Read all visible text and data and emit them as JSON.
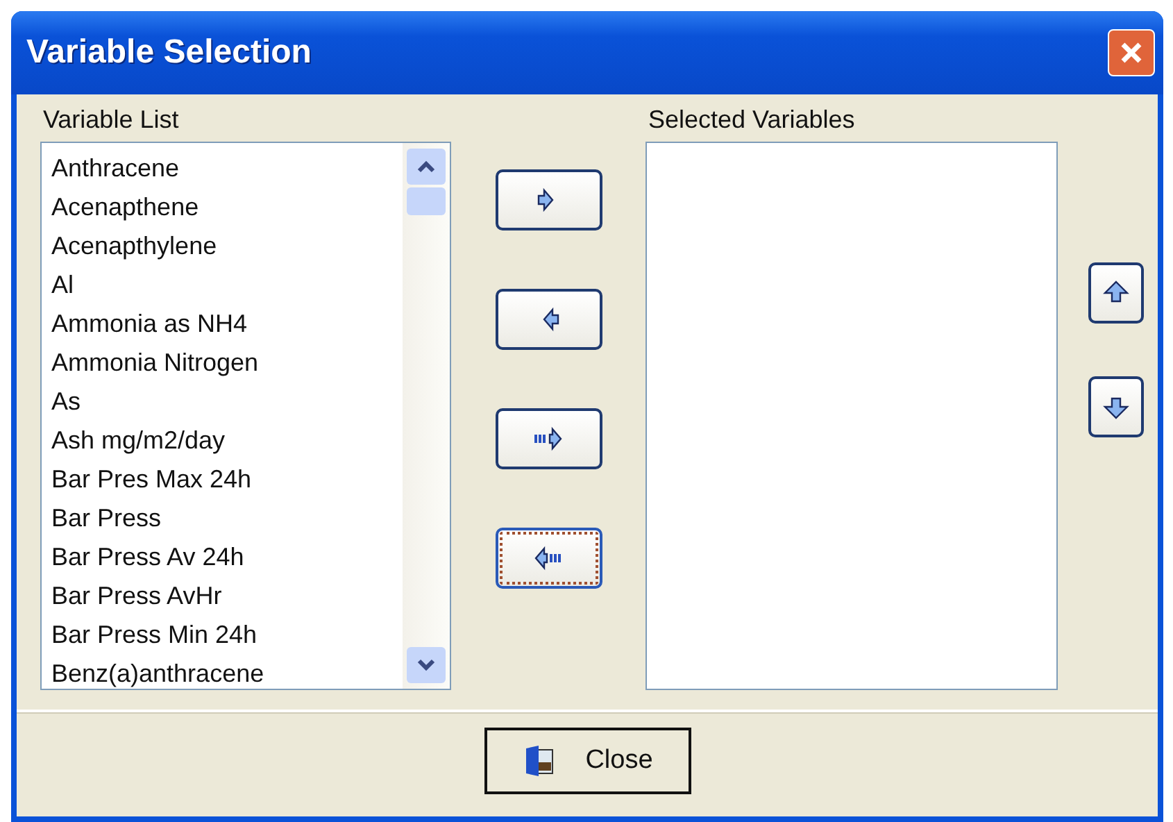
{
  "window": {
    "title": "Variable Selection"
  },
  "variable_list": {
    "label": "Variable List",
    "items": [
      "Anthracene",
      "Acenapthene",
      "Acenapthylene",
      "Al",
      "Ammonia as NH4",
      "Ammonia Nitrogen",
      "As",
      "Ash mg/m2/day",
      "Bar Pres Max 24h",
      "Bar Press",
      "Bar Press Av 24h",
      "Bar Press AvHr",
      "Bar Press Min 24h",
      "Benz(a)anthracene"
    ]
  },
  "transfer_buttons": [
    {
      "kind": "add",
      "focused": false
    },
    {
      "kind": "remove",
      "focused": false
    },
    {
      "kind": "add-all",
      "focused": false
    },
    {
      "kind": "remove-all",
      "focused": true
    }
  ],
  "selected_variables": {
    "label": "Selected Variables"
  },
  "order_buttons": [
    {
      "kind": "up"
    },
    {
      "kind": "down"
    }
  ],
  "close_button": {
    "label": "Close"
  }
}
